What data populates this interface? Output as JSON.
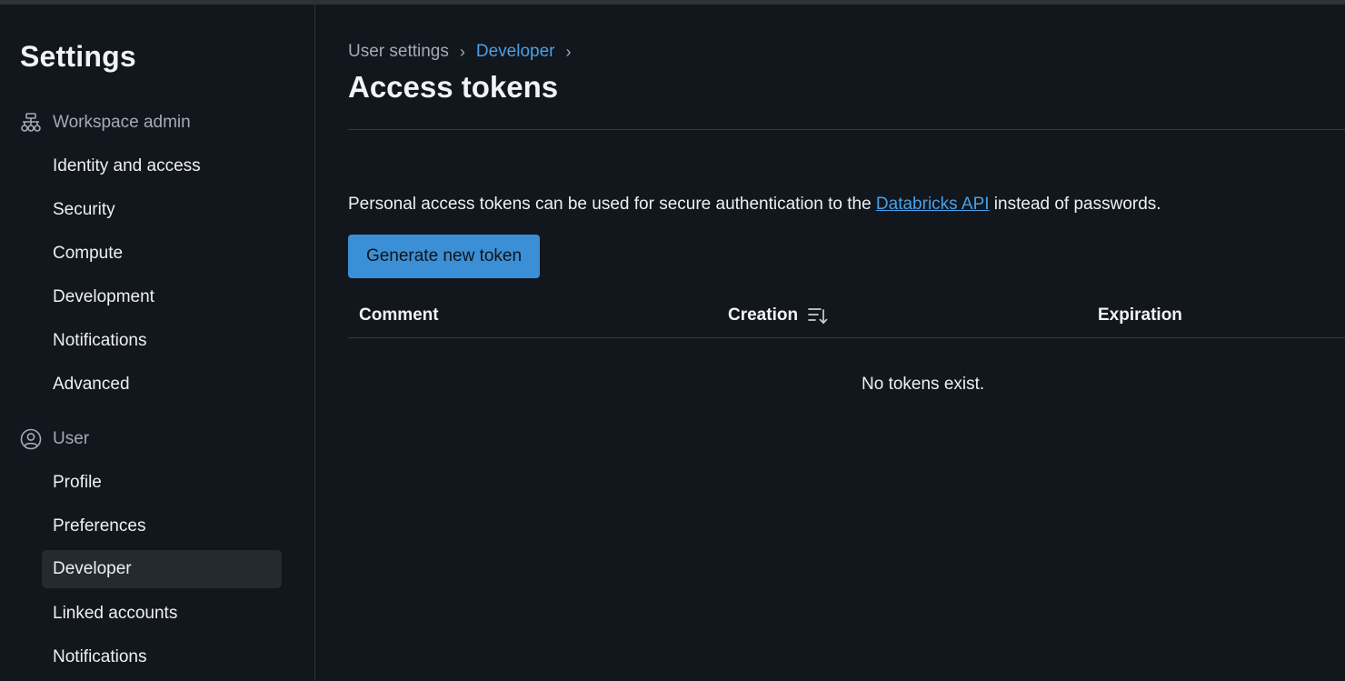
{
  "sidebar": {
    "title": "Settings",
    "workspace_admin": {
      "label": "Workspace admin",
      "icon": "hierarchy-icon",
      "items": [
        "Identity and access",
        "Security",
        "Compute",
        "Development",
        "Notifications",
        "Advanced"
      ]
    },
    "user": {
      "label": "User",
      "icon": "user-circle-icon",
      "items": [
        "Profile",
        "Preferences",
        "Developer",
        "Linked accounts",
        "Notifications"
      ]
    },
    "active_item": "Developer"
  },
  "breadcrumb": {
    "items": [
      "User settings",
      "Developer"
    ],
    "separator": "›"
  },
  "page": {
    "title": "Access tokens",
    "description_before": "Personal access tokens can be used for secure authentication to the ",
    "description_link": "Databricks API",
    "description_after": " instead of passwords.",
    "generate_button": "Generate new token"
  },
  "table": {
    "columns": [
      "Comment",
      "Creation",
      "Expiration"
    ],
    "sort_icon": "sort-descending-icon",
    "empty_message": "No tokens exist."
  },
  "colors": {
    "background": "#12161d",
    "accent": "#3b8fd6",
    "link": "#4aa0e6",
    "active_bg": "#252a31"
  }
}
